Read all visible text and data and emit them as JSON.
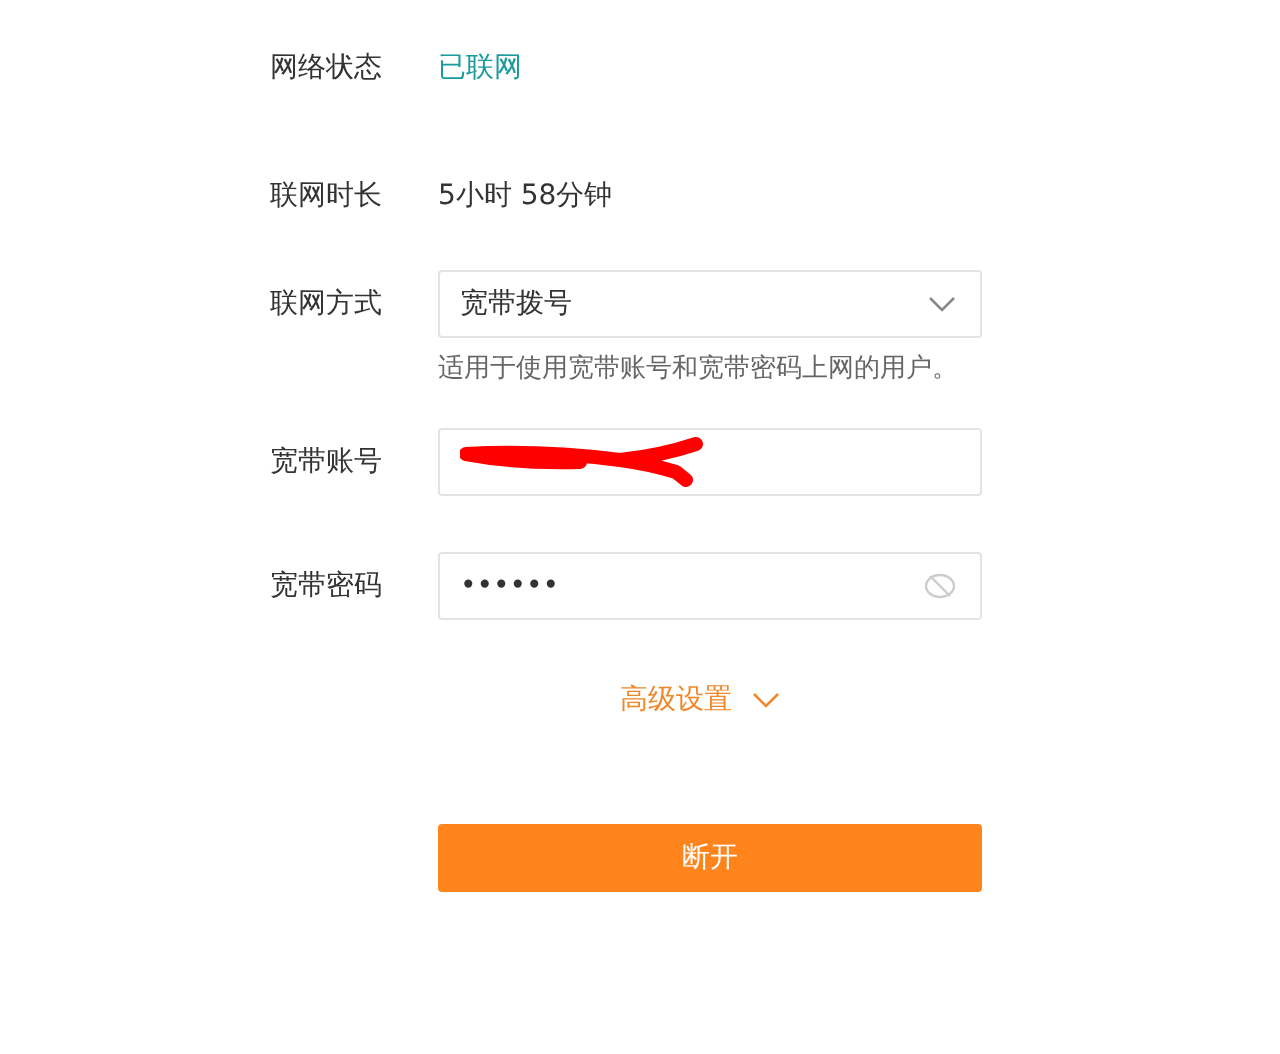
{
  "status": {
    "label": "网络状态",
    "value": "已联网"
  },
  "duration": {
    "label": "联网时长",
    "value": "5小时 58分钟"
  },
  "mode": {
    "label": "联网方式",
    "value": "宽带拨号",
    "hint": "适用于使用宽带账号和宽带密码上网的用户。"
  },
  "account": {
    "label": "宽带账号",
    "redacted": true
  },
  "password": {
    "label": "宽带密码",
    "value": "••••••",
    "visible": false
  },
  "advanced": {
    "label": "高级设置",
    "expanded": false
  },
  "button": {
    "label": "断开"
  }
}
